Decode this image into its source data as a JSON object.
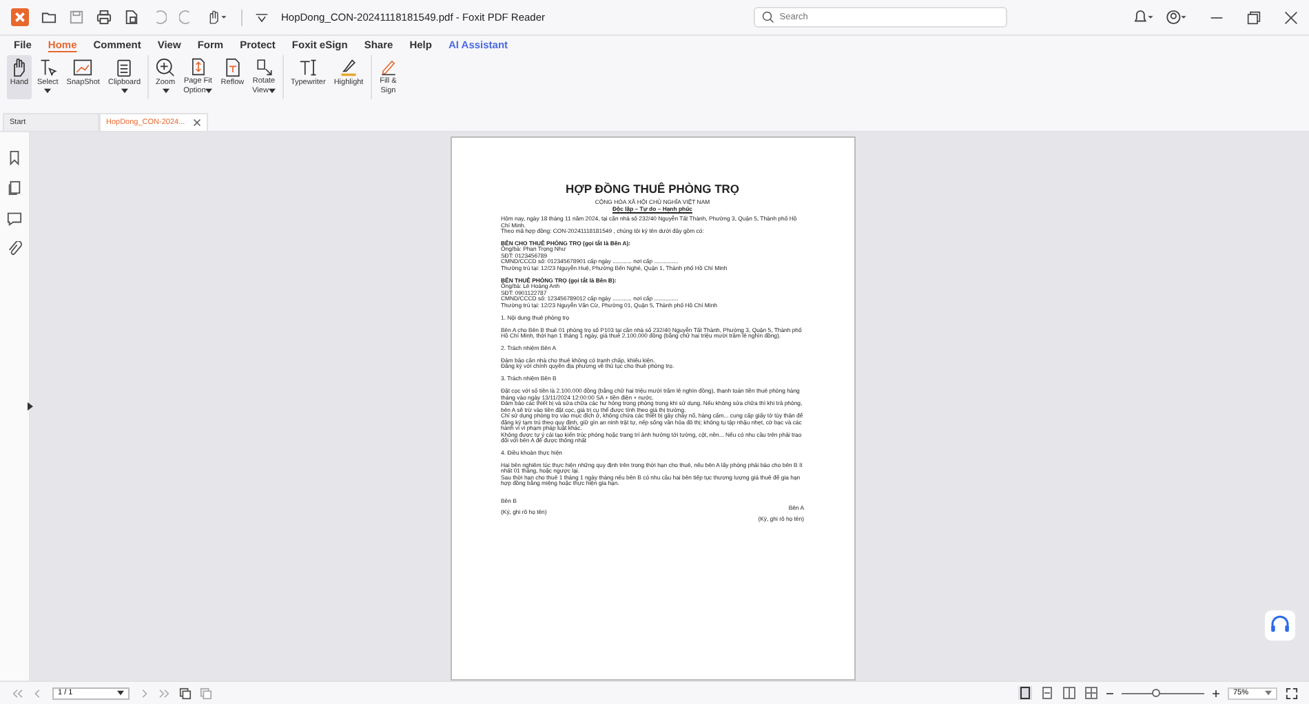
{
  "window": {
    "title": "HopDong_CON-20241118181549.pdf - Foxit PDF Reader"
  },
  "search": {
    "placeholder": "Search"
  },
  "menu_tabs": [
    {
      "label": "File",
      "selected": false,
      "kind": "plain"
    },
    {
      "label": "Home",
      "selected": true,
      "kind": "plain"
    },
    {
      "label": "Comment",
      "selected": false,
      "kind": "plain"
    },
    {
      "label": "View",
      "selected": false,
      "kind": "plain"
    },
    {
      "label": "Form",
      "selected": false,
      "kind": "plain"
    },
    {
      "label": "Protect",
      "selected": false,
      "kind": "plain"
    },
    {
      "label": "Foxit eSign",
      "selected": false,
      "kind": "plain"
    },
    {
      "label": "Share",
      "selected": false,
      "kind": "plain"
    },
    {
      "label": "Help",
      "selected": false,
      "kind": "plain"
    },
    {
      "label": "AI Assistant",
      "selected": false,
      "kind": "ai"
    }
  ],
  "ribbon_groups": [
    [
      {
        "lines": [
          "Hand"
        ],
        "dropdown": false,
        "selected": true
      },
      {
        "lines": [
          "Select"
        ],
        "dropdown": true,
        "selected": false
      },
      {
        "lines": [
          "SnapShot"
        ],
        "dropdown": false,
        "selected": false
      },
      {
        "lines": [
          "Clipboard"
        ],
        "dropdown": true,
        "selected": false
      }
    ],
    [
      {
        "lines": [
          "Zoom"
        ],
        "dropdown": true,
        "selected": false
      },
      {
        "lines": [
          "Page Fit",
          "Option"
        ],
        "dropdown": true,
        "selected": false
      },
      {
        "lines": [
          "Reflow"
        ],
        "dropdown": false,
        "selected": false
      },
      {
        "lines": [
          "Rotate",
          "View"
        ],
        "dropdown": true,
        "selected": false
      }
    ],
    [
      {
        "lines": [
          "Typewriter"
        ],
        "dropdown": false,
        "selected": false
      },
      {
        "lines": [
          "Highlight"
        ],
        "dropdown": false,
        "selected": false
      }
    ],
    [
      {
        "lines": [
          "Fill &",
          "Sign"
        ],
        "dropdown": false,
        "selected": false
      }
    ]
  ],
  "doc_tabs": [
    {
      "label": "Start",
      "selected": false,
      "closable": false
    },
    {
      "label": "HopDong_CON-2024...",
      "selected": true,
      "closable": true
    }
  ],
  "document": {
    "title": "HỢP ĐỒNG THUÊ PHÒNG TRỌ",
    "nation": "CỘNG HÒA XÃ HỘI CHỦ NGHĨA VIỆT NAM",
    "motto": "Độc lập – Tự do – Hạnh phúc",
    "sections": [
      [
        {
          "kind": "text",
          "text": "Hôm nay, ngày 18 tháng 11 năm 2024, tại căn nhà số 232/40 Nguyễn Tất Thành, Phường 3, Quận 5, Thành phố Hồ Chí Minh."
        },
        {
          "kind": "text",
          "text": "Theo mã hợp đồng: CON-20241118181549 , chúng tôi ký tên dưới đây gồm có:"
        }
      ],
      [
        {
          "kind": "bold",
          "text": "BÊN CHO THUÊ PHÒNG TRỌ (gọi tắt là Bên A):"
        },
        {
          "kind": "text",
          "text": "Ông/bà: Phan Trọng Như"
        },
        {
          "kind": "text",
          "text": "SĐT: 0123456789"
        },
        {
          "kind": "text",
          "text": "CMND/CCCD số: 012345678901 cấp ngày ............ nơi cấp ..............."
        },
        {
          "kind": "text",
          "text": "Thường trú tại: 12/23 Nguyễn Huệ, Phường Bến Nghé, Quận 1, Thành phố Hồ Chí Minh"
        }
      ],
      [
        {
          "kind": "bold",
          "text": "BÊN THUÊ PHÒNG TRỌ (gọi tắt là Bên B):"
        },
        {
          "kind": "text",
          "text": "Ông/bà: Lê Hoàng Anh"
        },
        {
          "kind": "text",
          "text": "SĐT: 0901122787"
        },
        {
          "kind": "text",
          "text": "CMND/CCCD số: 123456789012 cấp ngày ............ nơi cấp ..............."
        },
        {
          "kind": "text",
          "text": "Thường trú tại: 12/23 Nguyễn Văn Cừ, Phường 01, Quận 5, Thành phố Hồ Chí Minh"
        }
      ],
      [
        {
          "kind": "text",
          "text": "1. Nội dung thuê phòng trọ"
        }
      ],
      [
        {
          "kind": "text",
          "text": "Bên A cho Bên B thuê 01 phòng trọ số P103 tại căn nhà số 232/40 Nguyễn Tất Thành, Phường 3, Quận 5, Thành phố Hồ Chí Minh, thời hạn 1 tháng 1 ngày, giá thuê 2.100.000 đồng (bằng chữ hai triệu mười trăm lẻ nghìn đồng)."
        }
      ],
      [
        {
          "kind": "text",
          "text": "2. Trách nhiệm Bên A"
        }
      ],
      [
        {
          "kind": "text",
          "text": "Đảm bảo căn nhà cho thuê không có tranh chấp, khiếu kiện."
        },
        {
          "kind": "text",
          "text": "Đăng ký với chính quyền địa phương về thủ tục cho thuê phòng trọ."
        }
      ],
      [
        {
          "kind": "text",
          "text": "3. Trách nhiệm Bên B"
        }
      ],
      [
        {
          "kind": "text",
          "text": "Đặt cọc với số tiền là 2.100.000 đồng (bằng chữ hai triệu mười trăm lẻ nghìn đồng), thanh toán tiền thuê phòng hàng tháng vào ngày 13/11/2024 12:00:00 SA + tiền điện + nước."
        },
        {
          "kind": "text",
          "text": "Đảm bảo các thiết bị và sửa chữa các hư hỏng trong phòng trong khi sử dụng. Nếu không sửa chữa thì khi trả phòng, bên A sẽ trừ vào tiền đặt cọc, giá trị cụ thể được tính theo giá thị trường."
        },
        {
          "kind": "text",
          "text": "Chỉ sử dụng phòng trọ vào mục đích ở, không chứa các thiết bị gây cháy nổ, hàng cấm... cung cấp giấy tờ tùy thân để đăng ký tạm trú theo quy định, giữ gìn an ninh trật tự, nếp sống văn hóa đô thị; không tụ tập nhậu nhẹt, cờ bạc và các hành vi vi phạm pháp luật khác."
        },
        {
          "kind": "text",
          "text": "Không được tự ý cải tạo kiến trúc phòng hoặc trang trí ảnh hưởng tới tường, cột, nền... Nếu có nhu cầu trên phải trao đổi với bên A để được thống nhất"
        }
      ],
      [
        {
          "kind": "text",
          "text": "4. Điều khoản thực hiện"
        }
      ],
      [
        {
          "kind": "text",
          "text": "Hai bên nghiêm túc thực hiện những quy định trên trong thời hạn cho thuê, nếu bên A lấy phòng phải báo cho bên B ít nhất 01 tháng, hoặc ngược lại."
        },
        {
          "kind": "text",
          "text": "Sau thời hạn cho thuê 1 tháng 1 ngày tháng nếu bên B có nhu cầu hai bên tiếp tục thương lượng giá thuê để gia hạn hợp đồng bằng miệng hoặc thực hiện gia hạn."
        }
      ]
    ],
    "signatures": [
      {
        "party": "Bên B",
        "note": "(Ký, ghi rõ họ tên)"
      },
      {
        "party": "Bên A",
        "note": "(Ký, ghi rõ họ tên)"
      }
    ]
  },
  "status_bar": {
    "page": "1 / 1",
    "zoom": "75%",
    "zoom_slider": {
      "level": 0.42
    }
  }
}
